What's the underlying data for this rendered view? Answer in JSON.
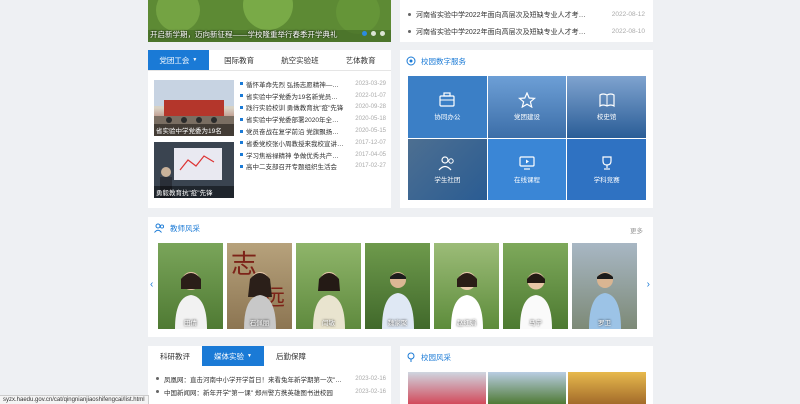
{
  "banner": {
    "caption": "开启新学期，迈向新征程——学校隆重举行春季开学典礼",
    "slides": 3,
    "active_slide": 1
  },
  "top_news": [
    {
      "title": "河南省实验中学2022年面向高层次及短缺专业人才考…",
      "date": "2022-08-12"
    },
    {
      "title": "河南省实验中学2022年面向高层次及短缺专业人才考…",
      "date": "2022-08-10"
    }
  ],
  "news_card": {
    "tabs": [
      {
        "label": "党团工会",
        "active": true
      },
      {
        "label": "国际教育",
        "active": false
      },
      {
        "label": "航空实验班",
        "active": false
      },
      {
        "label": "艺体教育",
        "active": false
      }
    ],
    "photos": [
      {
        "caption": "省实验中学党委为19名"
      },
      {
        "caption": "勇毅教育抗\"疫\"先锋"
      }
    ],
    "items": [
      {
        "title": "循怀革命先烈 弘扬志愿精神—…",
        "date": "2023-03-29"
      },
      {
        "title": "省实验中学党委为19名新党员…",
        "date": "2022-01-07"
      },
      {
        "title": "践行实验校训 勇做教育抗\"疫\"先锋",
        "date": "2020-09-28"
      },
      {
        "title": "省实验中学党委部署2020年全…",
        "date": "2020-05-18"
      },
      {
        "title": "党员奋战在复学前沿 党旗飘扬…",
        "date": "2020-05-15"
      },
      {
        "title": "省委党校张小周教授来我校宣讲…",
        "date": "2017-12-07"
      },
      {
        "title": "学习焦裕禄精神 争做优秀共产…",
        "date": "2017-04-05"
      },
      {
        "title": "高中二支部召开专题组织生活会",
        "date": "2017-02-27"
      }
    ]
  },
  "services": {
    "title": "校园数字服务",
    "items": [
      {
        "label": "协同办公",
        "icon": "briefcase-icon"
      },
      {
        "label": "党团建设",
        "icon": "star-icon"
      },
      {
        "label": "校史馆",
        "icon": "book-icon"
      },
      {
        "label": "学生社团",
        "icon": "people-icon"
      },
      {
        "label": "在线课程",
        "icon": "screen-icon"
      },
      {
        "label": "学科竞赛",
        "icon": "trophy-icon"
      }
    ]
  },
  "teachers": {
    "title": "教师风采",
    "more": "更多",
    "people": [
      {
        "name": "田倩"
      },
      {
        "name": "石佩丽"
      },
      {
        "name": "闫敏"
      },
      {
        "name": "魏家聚"
      },
      {
        "name": "赵红娟"
      },
      {
        "name": "马宁"
      },
      {
        "name": "罗卫"
      }
    ]
  },
  "research": {
    "tabs": [
      {
        "label": "科研教评",
        "active": false
      },
      {
        "label": "媒体实验",
        "active": true
      },
      {
        "label": "后勤保障",
        "active": false
      }
    ],
    "items": [
      {
        "title": "凤凰网：直击河南中小学开学首日！来看兔年新学期第一次\"…",
        "date": "2023-02-16"
      },
      {
        "title": "中国新闻网：新年开学\"第一课\" 郑州警方携英雄图书进校园",
        "date": "2023-02-16"
      }
    ]
  },
  "campus": {
    "title": "校园风采"
  },
  "status_url": "syzx.haedu.gov.cn/cat/qingnianjiaoshifengcai/list.html",
  "colors": {
    "primary": "#1a7ad6",
    "page_bg": "#eef0f3"
  }
}
